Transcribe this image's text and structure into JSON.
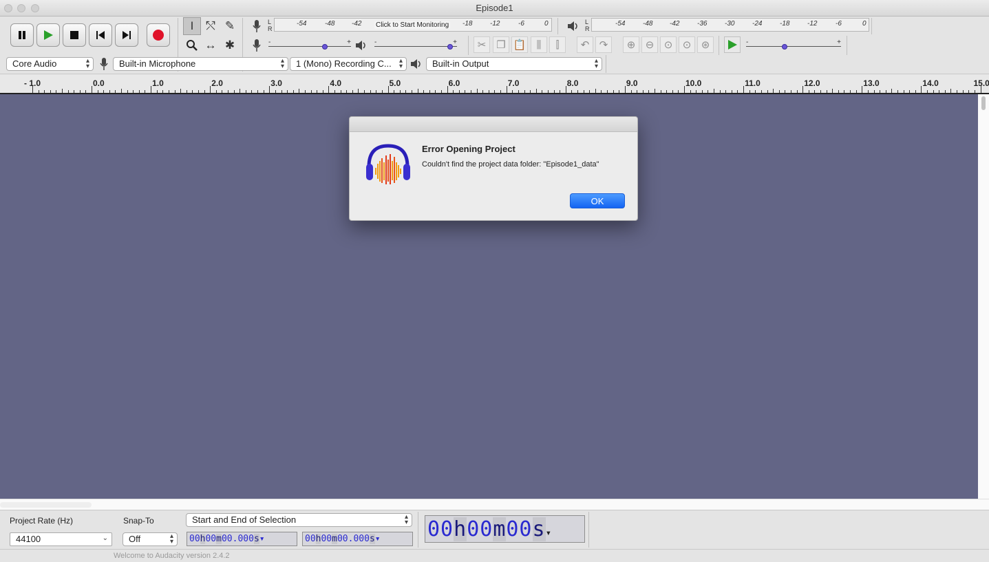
{
  "window": {
    "title": "Episode1"
  },
  "transport": {
    "colors": {
      "play": "#2aa02a",
      "record": "#e0132a"
    }
  },
  "recording_meter": {
    "left_label": "L",
    "right_label": "R",
    "ticks": [
      "-54",
      "-48",
      "-42",
      "-18",
      "-12",
      "-6",
      "0"
    ],
    "monitor_text": "Click to Start Monitoring"
  },
  "playback_meter": {
    "left_label": "L",
    "right_label": "R",
    "ticks": [
      "-54",
      "-48",
      "-42",
      "-36",
      "-30",
      "-24",
      "-18",
      "-12",
      "-6",
      "0"
    ]
  },
  "mixer": {
    "minus": "-",
    "plus": "+",
    "rec_volume_level": 0.7,
    "play_volume_level": 0.96,
    "play_speed_level": 0.4
  },
  "device_bar": {
    "host": "Core Audio",
    "input_device": "Built-in Microphone",
    "channels": "1 (Mono) Recording C...",
    "output_device": "Built-in Output"
  },
  "ruler": {
    "labels": [
      "- 1.0",
      "0.0",
      "1.0",
      "2.0",
      "3.0",
      "4.0",
      "5.0",
      "6.0",
      "7.0",
      "8.0",
      "9.0",
      "10.0",
      "11.0",
      "12.0",
      "13.0",
      "14.0",
      "15.0"
    ]
  },
  "dialog": {
    "heading": "Error Opening Project",
    "message": "Couldn't find the project data folder: \"Episode1_data\"",
    "ok_label": "OK"
  },
  "selection_bar": {
    "project_rate_label": "Project Rate (Hz)",
    "project_rate_value": "44100",
    "snap_to_label": "Snap-To",
    "snap_to_value": "Off",
    "selection_mode": "Start and End of Selection",
    "start_time": {
      "h": "00",
      "hu": "h",
      "m": "00",
      "mu": "m",
      "s": "00.000",
      "su": "s"
    },
    "end_time": {
      "h": "00",
      "hu": "h",
      "m": "00",
      "mu": "m",
      "s": "00.000",
      "su": "s"
    },
    "audio_position": {
      "h": "00",
      "hu": "h",
      "m": "00",
      "mu": "m",
      "s": "00",
      "su": "s"
    }
  },
  "status": {
    "text": "Welcome to Audacity version 2.4.2"
  }
}
